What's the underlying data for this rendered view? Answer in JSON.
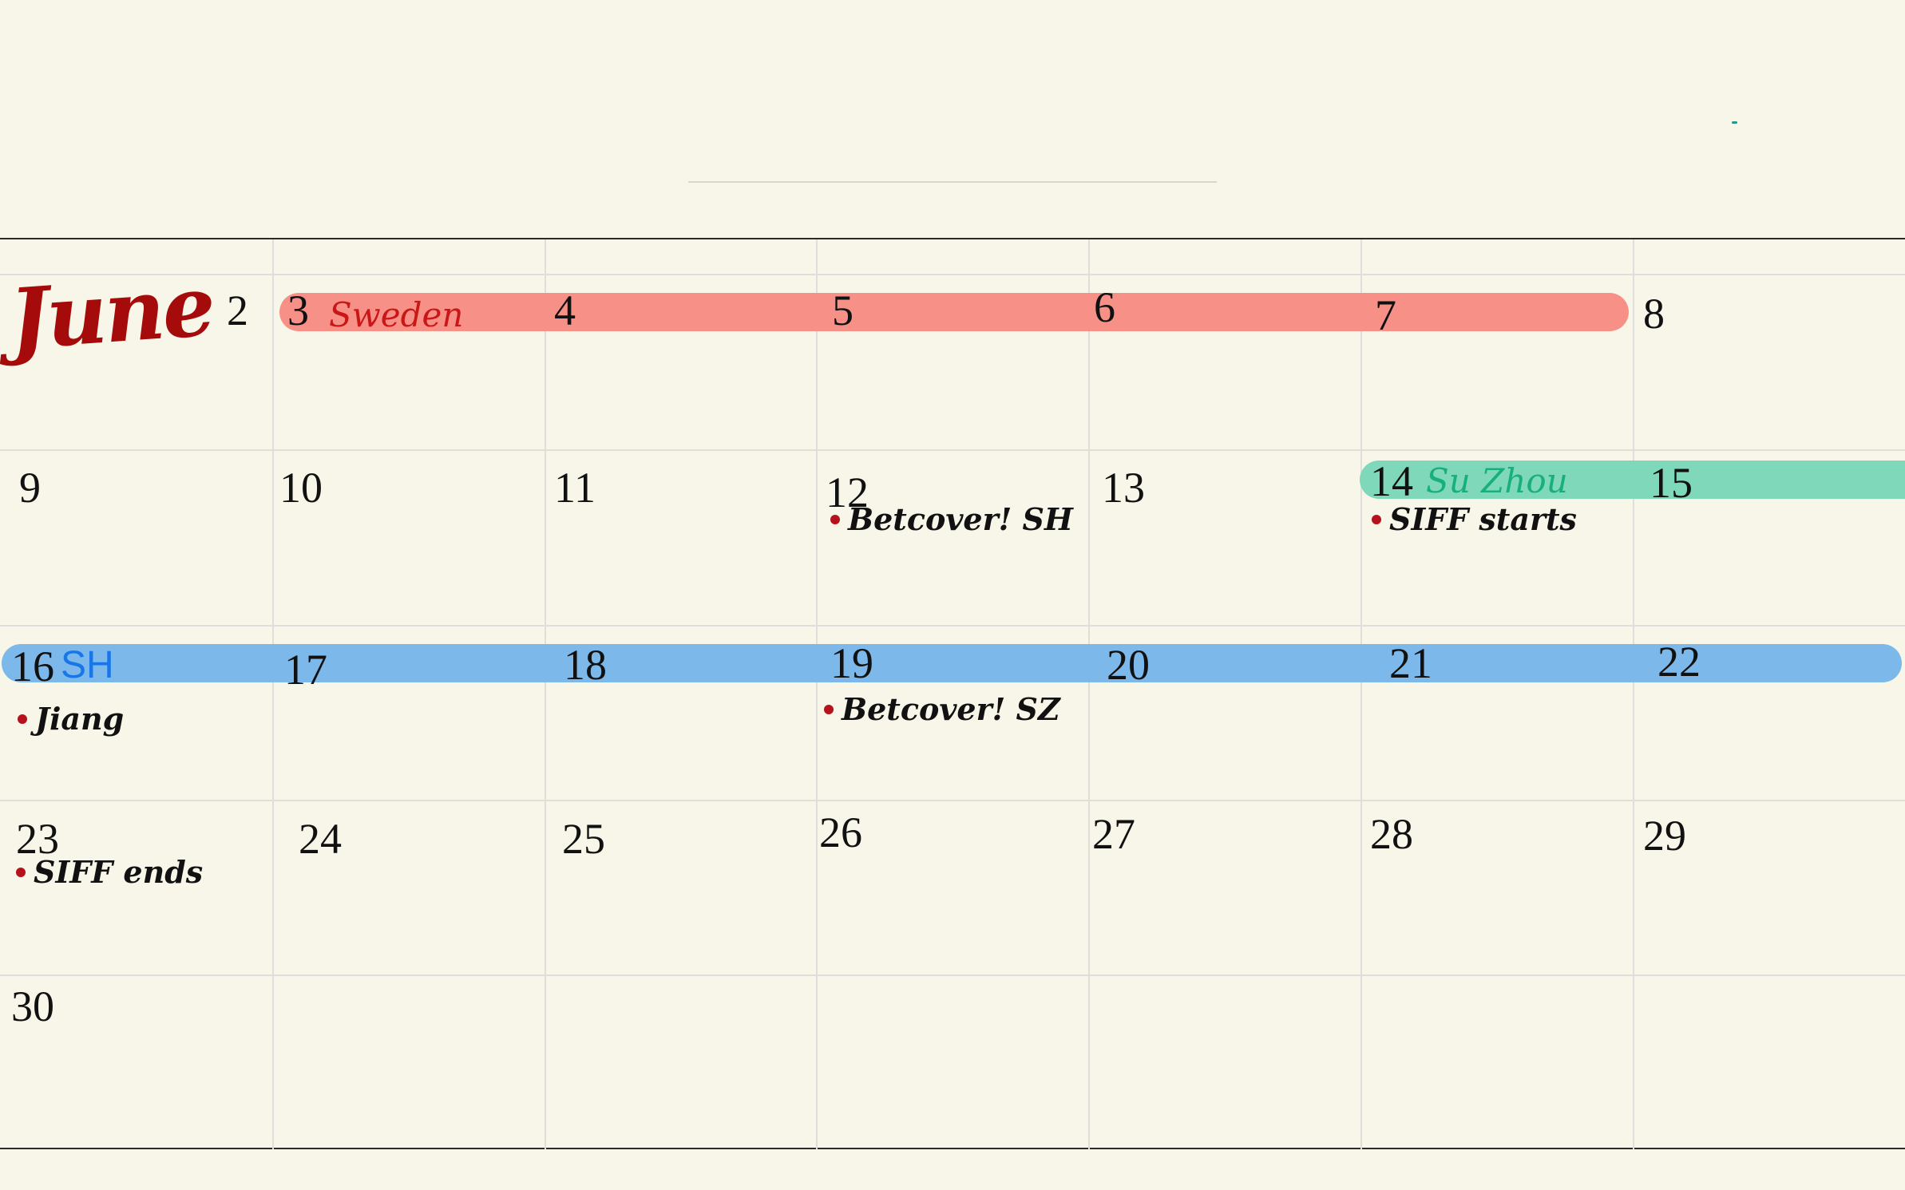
{
  "calendar": {
    "month_title": "June",
    "days": [
      "2",
      "3",
      "4",
      "5",
      "6",
      "7",
      "8",
      "9",
      "10",
      "11",
      "12",
      "13",
      "14",
      "15",
      "16",
      "17",
      "18",
      "19",
      "20",
      "21",
      "22",
      "23",
      "24",
      "25",
      "26",
      "27",
      "28",
      "29",
      "30"
    ],
    "events": [
      {
        "label": "Sweden",
        "label_color": "#c91717",
        "bar_color": "#f79086"
      },
      {
        "label": "Su Zhou",
        "label_color": "#17b07a",
        "bar_color": "#7fd8b9"
      },
      {
        "label": "SH",
        "label_color": "#1976e8",
        "bar_color": "#7db8ea"
      }
    ],
    "notes": [
      {
        "text": "Betcover! SH"
      },
      {
        "text": "SIFF starts"
      },
      {
        "text": "Jiang"
      },
      {
        "text": "Betcover! SZ"
      },
      {
        "text": "SIFF ends"
      }
    ]
  },
  "colors": {
    "background": "#f8f6e9",
    "grid": "#dededa",
    "ink": "#111111",
    "bullet": "#b5121b",
    "month_title": "#a50b0b"
  }
}
